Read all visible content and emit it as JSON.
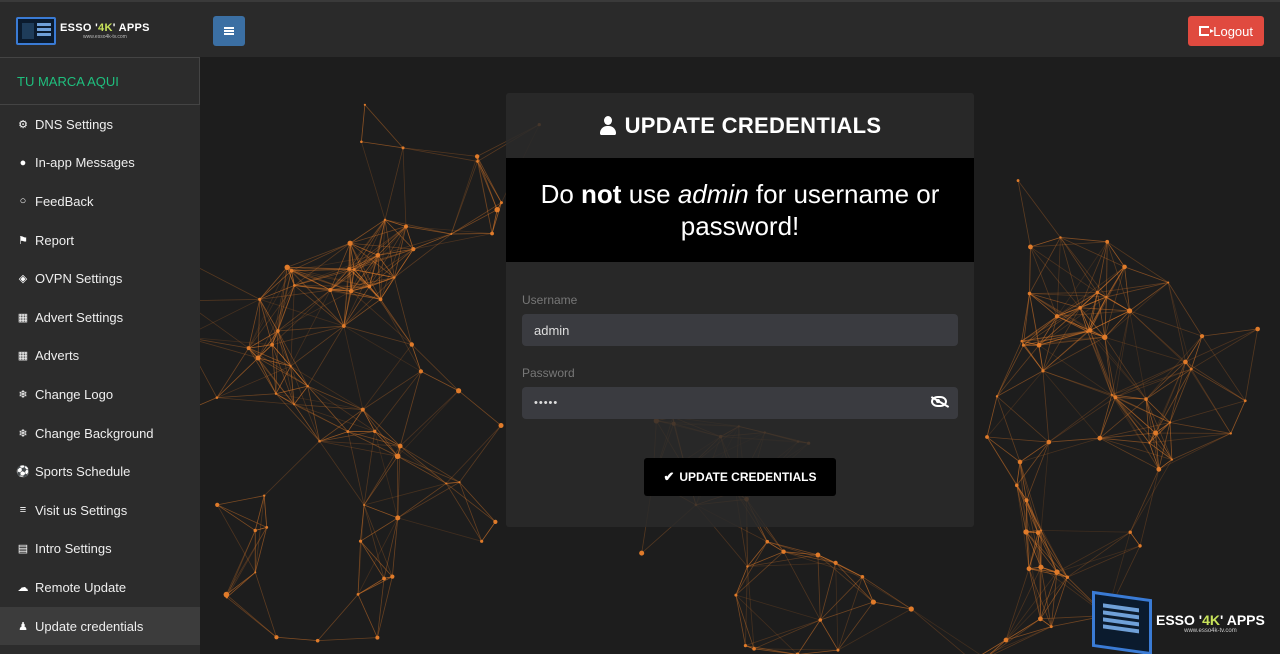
{
  "header": {
    "brand_name_prefix": "ESSO '",
    "brand_name_k": "4K",
    "brand_name_suffix": "' APPS",
    "brand_url": "www.esso4k-tv.com",
    "logout_label": "Logout"
  },
  "sidebar": {
    "brand_tag": "TU MARCA AQUI",
    "items": [
      {
        "label": "DNS Settings",
        "icon": "cogs-icon"
      },
      {
        "label": "In-app Messages",
        "icon": "chat-icon"
      },
      {
        "label": "FeedBack",
        "icon": "comment-icon"
      },
      {
        "label": "Report",
        "icon": "flag-icon"
      },
      {
        "label": "OVPN Settings",
        "icon": "shield-icon"
      },
      {
        "label": "Advert Settings",
        "icon": "grid-icon"
      },
      {
        "label": "Adverts",
        "icon": "grid-icon"
      },
      {
        "label": "Change Logo",
        "icon": "snowflake-icon"
      },
      {
        "label": "Change Background",
        "icon": "snowflake-icon"
      },
      {
        "label": "Sports Schedule",
        "icon": "football-icon"
      },
      {
        "label": "Visit us Settings",
        "icon": "sliders-icon"
      },
      {
        "label": "Intro Settings",
        "icon": "film-icon"
      },
      {
        "label": "Remote Update",
        "icon": "cloud-upload-icon"
      },
      {
        "label": "Update credentials",
        "icon": "user-icon"
      }
    ],
    "active_index": 13
  },
  "card": {
    "title": "UPDATE CREDENTIALS",
    "warning_part1": "Do ",
    "warning_bold": "not",
    "warning_part2": " use ",
    "warning_italic": "admin",
    "warning_part3": " for username or",
    "warning_line2": "password!",
    "username_label": "Username",
    "username_value": "admin",
    "password_label": "Password",
    "password_value": "•••••",
    "submit_label": "UPDATE CREDENTIALS"
  },
  "watermark": {
    "name_prefix": "ESSO '",
    "name_k": "4K",
    "name_suffix": "' APPS",
    "url": "www.esso4k-tv.com"
  },
  "colors": {
    "accent_green": "#1fbf7e",
    "menu_button": "#3b6fa3",
    "logout_button": "#e04a3f",
    "network_lines": "#e07b2a"
  }
}
